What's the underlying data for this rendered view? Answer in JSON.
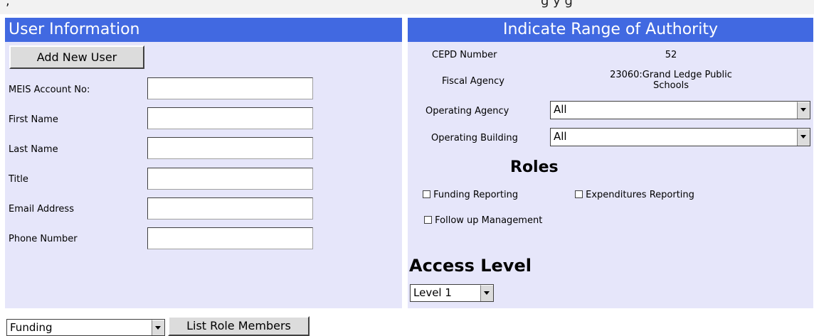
{
  "top_text": {
    "left_fragment": ";",
    "right_fragment": "g   y g"
  },
  "user_info": {
    "header": "User Information",
    "add_user_button": "Add New User",
    "fields": [
      {
        "label": "MEIS Account No:",
        "value": ""
      },
      {
        "label": "First Name",
        "value": ""
      },
      {
        "label": "Last Name",
        "value": ""
      },
      {
        "label": "Title",
        "value": ""
      },
      {
        "label": "Email Address",
        "value": ""
      },
      {
        "label": "Phone Number",
        "value": ""
      }
    ]
  },
  "authority": {
    "header": "Indicate Range of Authority",
    "cepd_label": "CEPD Number",
    "cepd_value": "52",
    "fiscal_label": "Fiscal Agency",
    "fiscal_value_line1": "23060:Grand Ledge Public",
    "fiscal_value_line2": "Schools",
    "operating_agency_label": "Operating Agency",
    "operating_agency_value": "All",
    "operating_building_label": "Operating Building",
    "operating_building_value": "All"
  },
  "roles": {
    "title": "Roles",
    "items": [
      {
        "label": "Funding Reporting",
        "checked": false
      },
      {
        "label": "Expenditures Reporting",
        "checked": false
      },
      {
        "label": "Follow up Management",
        "checked": false
      }
    ]
  },
  "access": {
    "title": "Access Level",
    "selected": "Level 1"
  },
  "bottom": {
    "role_select_value": "Funding",
    "list_members_button": "List Role Members"
  }
}
